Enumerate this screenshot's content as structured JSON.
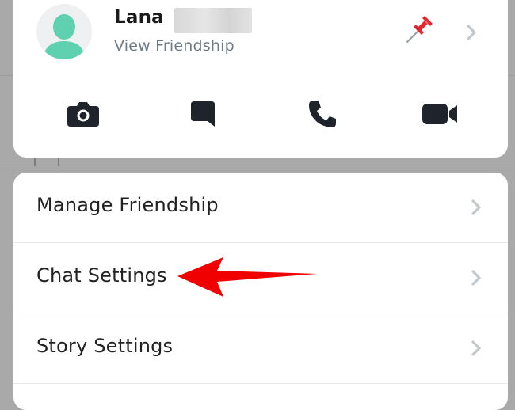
{
  "friend": {
    "name": "Lana",
    "subtitle": "View Friendship"
  },
  "header_icons": {
    "pin": "pin-icon",
    "chevron": "chevron-right-icon"
  },
  "actions": [
    {
      "name": "camera",
      "icon": "camera-icon"
    },
    {
      "name": "chat",
      "icon": "chat-bubble-icon"
    },
    {
      "name": "call",
      "icon": "phone-icon"
    },
    {
      "name": "video",
      "icon": "video-camera-icon"
    }
  ],
  "menu": {
    "items": [
      {
        "label": "Manage Friendship"
      },
      {
        "label": "Chat Settings"
      },
      {
        "label": "Story Settings"
      }
    ]
  },
  "colors": {
    "avatar": "#5fd0b0",
    "annotation_arrow": "#f00000",
    "subtitle": "#6c7a86",
    "chevron": "#c3c8cc",
    "icons": "#1f232b"
  }
}
